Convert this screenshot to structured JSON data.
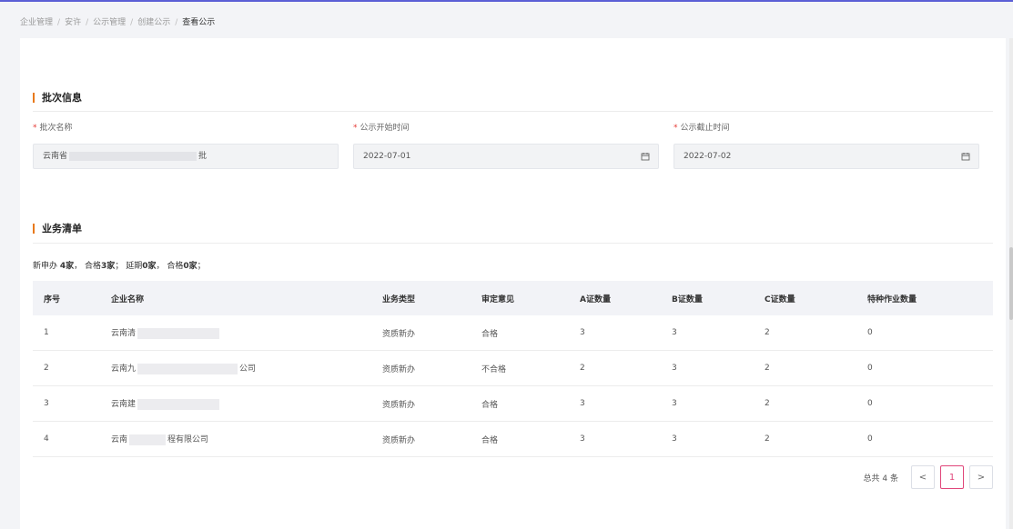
{
  "breadcrumb": {
    "items": [
      "企业管理",
      "安许",
      "公示管理",
      "创建公示"
    ],
    "current": "查看公示",
    "separator": "/"
  },
  "batch_info": {
    "title": "批次信息",
    "name_label": "批次名称",
    "name_prefix": "云南省",
    "name_suffix": "批",
    "start_label": "公示开始时间",
    "start_value": "2022-07-01",
    "end_label": "公示截止时间",
    "end_value": "2022-07-02"
  },
  "business_list": {
    "title": "业务清单",
    "summary": {
      "new_label": "新申办",
      "new_count": "4家",
      "pass1_label": "合格",
      "pass1_count": "3家",
      "delay_label": "延期",
      "delay_count": "0家",
      "pass2_label": "合格",
      "pass2_count": "0家"
    }
  },
  "table": {
    "headers": [
      "序号",
      "企业名称",
      "业务类型",
      "审定意见",
      "A证数量",
      "B证数量",
      "C证数量",
      "特种作业数量"
    ],
    "rows": [
      {
        "no": "1",
        "name_prefix": "云南清",
        "name_suffix": "",
        "type": "资质新办",
        "opinion": "合格",
        "a": "3",
        "b": "3",
        "c": "2",
        "special": "0"
      },
      {
        "no": "2",
        "name_prefix": "云南九",
        "name_suffix": "公司",
        "type": "资质新办",
        "opinion": "不合格",
        "a": "2",
        "b": "3",
        "c": "2",
        "special": "0"
      },
      {
        "no": "3",
        "name_prefix": "云南建",
        "name_suffix": "",
        "type": "资质新办",
        "opinion": "合格",
        "a": "3",
        "b": "3",
        "c": "2",
        "special": "0"
      },
      {
        "no": "4",
        "name_prefix": "云南",
        "name_suffix": "程有限公司",
        "type": "资质新办",
        "opinion": "合格",
        "a": "3",
        "b": "3",
        "c": "2",
        "special": "0"
      }
    ]
  },
  "pagination": {
    "total_text": "总共 4 条",
    "prev": "<",
    "current": "1",
    "next": ">"
  },
  "icons": {
    "calendar": "calendar-icon",
    "prev": "chevron-left-icon",
    "next": "chevron-right-icon"
  },
  "colors": {
    "accent": "#e8791b",
    "required": "#e53935",
    "pager_active": "#e0467a",
    "top_line": "#5b5fd6"
  }
}
